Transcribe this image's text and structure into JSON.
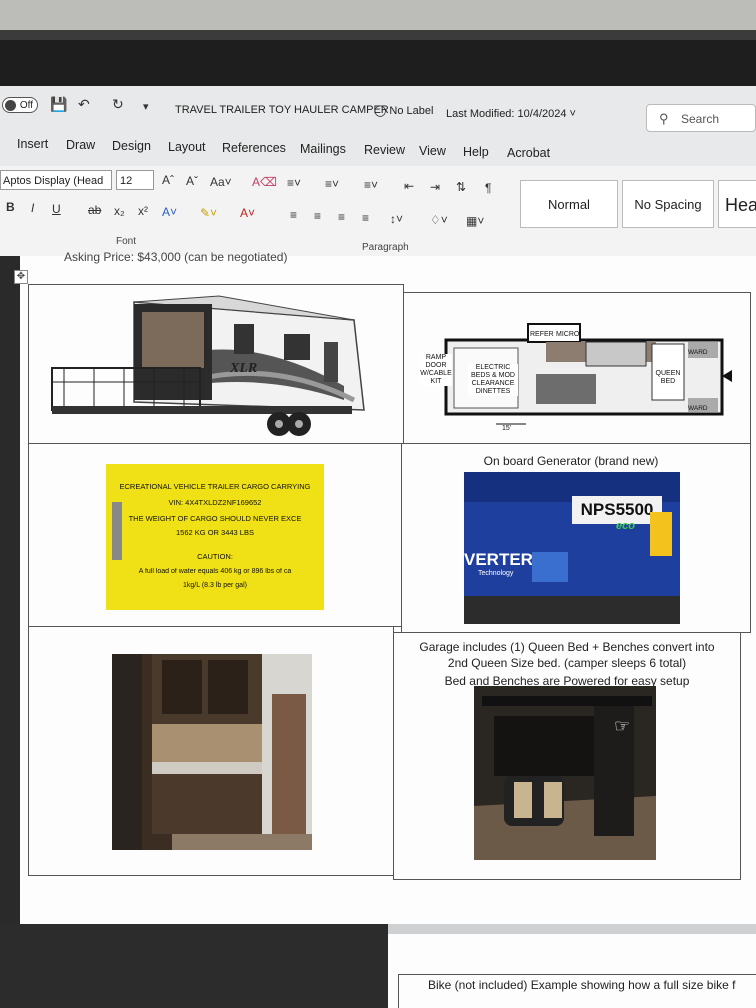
{
  "titlebar": {
    "autosave": "Off",
    "doc_title": "TRAVEL TRAILER TOY HAULER CAMPER",
    "sensitivity": "No Label",
    "last_modified": "Last Modified: 10/4/2024",
    "search_placeholder": "Search"
  },
  "menu": [
    "Insert",
    "Draw",
    "Design",
    "Layout",
    "References",
    "Mailings",
    "Review",
    "View",
    "Help",
    "Acrobat"
  ],
  "ribbon": {
    "font_name": "Aptos Display (Head",
    "font_size": "12",
    "group_font": "Font",
    "group_paragraph": "Paragraph",
    "styles": [
      "Normal",
      "No Spacing",
      "Hea"
    ]
  },
  "document": {
    "asking_price": "Asking Price: $43,000 (can be negotiated)",
    "trailer_brand": "XLR",
    "floorplan": {
      "ramp": "RAMP DOOR W/CABLE KIT",
      "refer": "REFER",
      "micro": "MICRO",
      "electric": "ELECTRIC BEDS & MOD CLEARANCE DINETTES",
      "queen": "QUEEN BED",
      "ward_top": "WARD",
      "ward_bottom": "WARD",
      "length": "15'"
    },
    "cargo_label": {
      "line1": "ECREATIONAL VEHICLE TRAILER CARGO CARRYING",
      "line2": "VIN:  4X4TXLDZ2NF169652",
      "line3": "THE WEIGHT OF CARGO SHOULD NEVER EXCE",
      "line4": "1562 KG OR 3443 LBS",
      "line5": "CAUTION:",
      "line6": "A full load of water equals 406 kg or 896 lbs of ca",
      "line7": "1kg/L (8.3 lb per gal)"
    },
    "generator_caption": "On board Generator (brand new)",
    "generator": {
      "model": "NPS5500",
      "eco": "eco",
      "brand": "VERTER",
      "brand_sub": "Technology"
    },
    "garage_caption_1": "Garage includes (1) Queen Bed + Benches convert into",
    "garage_caption_2": "2nd Queen Size bed.  (camper sleeps 6 total)",
    "garage_caption_3": "Bed and Benches are Powered for easy setup",
    "bike_caption": "Bike (not included) Example showing how a full size bike f"
  }
}
